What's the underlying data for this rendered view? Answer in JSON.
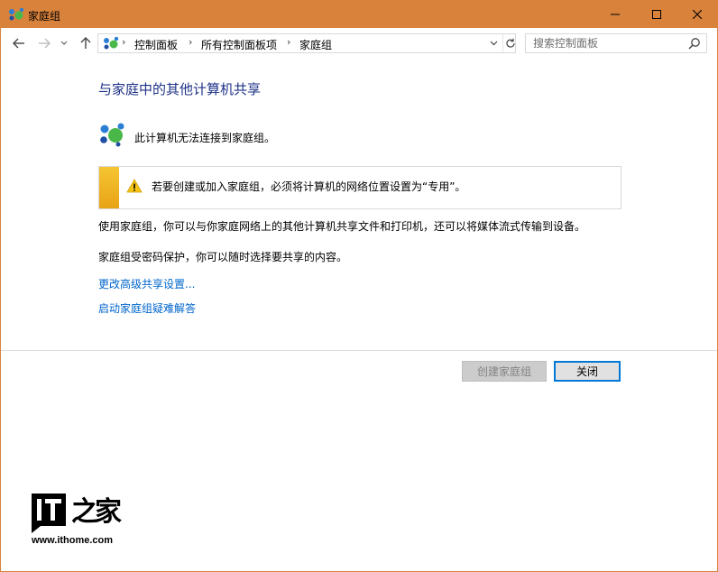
{
  "window": {
    "title": "家庭组",
    "title_bar_color": "#d9823b",
    "icons": {
      "app": "homegroup-icon",
      "minimize": "minimize-icon",
      "maximize": "maximize-icon",
      "close": "close-icon"
    }
  },
  "navigation": {
    "back": "back-arrow-icon",
    "forward": "forward-arrow-icon",
    "recent": "chevron-down-icon",
    "up": "up-arrow-icon",
    "breadcrumbs": [
      "控制面板",
      "所有控制面板项",
      "家庭组"
    ],
    "search_placeholder": "搜索控制面板"
  },
  "main": {
    "heading": "与家庭中的其他计算机共享",
    "status_text": "此计算机无法连接到家庭组。",
    "warning": "若要创建或加入家庭组，必须将计算机的网络位置设置为“专用”。",
    "description": "使用家庭组，你可以与你家庭网络上的其他计算机共享文件和打印机，还可以将媒体流式传输到设备。",
    "password_note": "家庭组受密码保护，你可以随时选择要共享的内容。",
    "links": [
      "更改高级共享设置...",
      "启动家庭组疑难解答"
    ],
    "link_color": "#0066cc",
    "heading_color": "#1e3287"
  },
  "footer": {
    "create_button": "创建家庭组",
    "close_button": "关闭"
  },
  "watermark": {
    "url": "www.ithome.com"
  }
}
